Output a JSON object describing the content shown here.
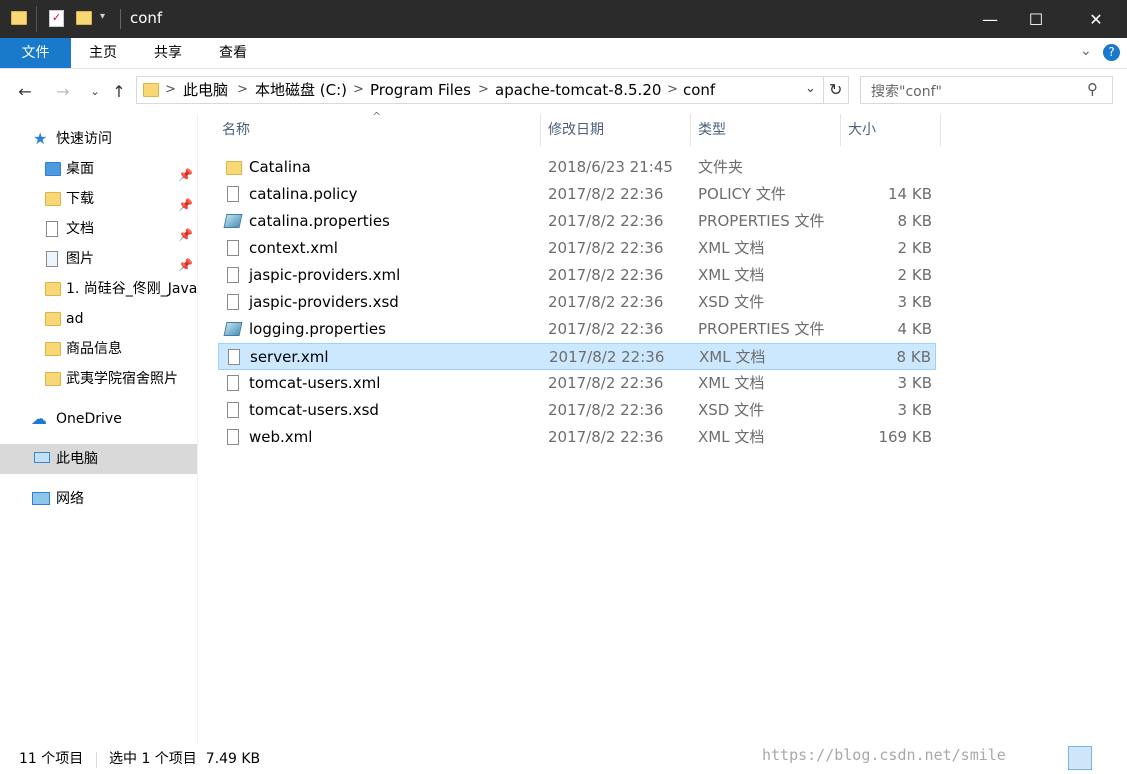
{
  "window": {
    "title": "conf",
    "minimize": "—",
    "maximize": "☐",
    "close": "✕"
  },
  "ribbon": {
    "tabs": [
      "文件",
      "主页",
      "共享",
      "查看"
    ],
    "expand_icon": "chevron-down-icon",
    "help": "?"
  },
  "address": {
    "crumbs": [
      "此电脑",
      "本地磁盘 (C:)",
      "Program Files",
      "apache-tomcat-8.5.20",
      "conf"
    ],
    "separator": ">",
    "search_placeholder": "搜索\"conf\""
  },
  "sidebar": {
    "quick_access": "快速访问",
    "items": [
      {
        "label": "桌面",
        "pinned": true
      },
      {
        "label": "下载",
        "pinned": true
      },
      {
        "label": "文档",
        "pinned": true
      },
      {
        "label": "图片",
        "pinned": true
      },
      {
        "label": "1. 尚硅谷_佟刚_Java",
        "pinned": false
      },
      {
        "label": "ad",
        "pinned": false
      },
      {
        "label": "商品信息",
        "pinned": false
      },
      {
        "label": "武夷学院宿舍照片",
        "pinned": false
      }
    ],
    "onedrive": "OneDrive",
    "this_pc": "此电脑",
    "network": "网络"
  },
  "columns": {
    "name": "名称",
    "date": "修改日期",
    "type": "类型",
    "size": "大小"
  },
  "files": [
    {
      "name": "Catalina",
      "date": "2018/6/23 21:45",
      "type": "文件夹",
      "size": "",
      "icon": "folder-icon"
    },
    {
      "name": "catalina.policy",
      "date": "2017/8/2 22:36",
      "type": "POLICY 文件",
      "size": "14 KB",
      "icon": "document-icon"
    },
    {
      "name": "catalina.properties",
      "date": "2017/8/2 22:36",
      "type": "PROPERTIES 文件",
      "size": "8 KB",
      "icon": "properties-icon"
    },
    {
      "name": "context.xml",
      "date": "2017/8/2 22:36",
      "type": "XML 文档",
      "size": "2 KB",
      "icon": "document-icon"
    },
    {
      "name": "jaspic-providers.xml",
      "date": "2017/8/2 22:36",
      "type": "XML 文档",
      "size": "2 KB",
      "icon": "document-icon"
    },
    {
      "name": "jaspic-providers.xsd",
      "date": "2017/8/2 22:36",
      "type": "XSD 文件",
      "size": "3 KB",
      "icon": "document-icon"
    },
    {
      "name": "logging.properties",
      "date": "2017/8/2 22:36",
      "type": "PROPERTIES 文件",
      "size": "4 KB",
      "icon": "properties-icon"
    },
    {
      "name": "server.xml",
      "date": "2017/8/2 22:36",
      "type": "XML 文档",
      "size": "8 KB",
      "icon": "document-icon",
      "selected": true
    },
    {
      "name": "tomcat-users.xml",
      "date": "2017/8/2 22:36",
      "type": "XML 文档",
      "size": "3 KB",
      "icon": "document-icon"
    },
    {
      "name": "tomcat-users.xsd",
      "date": "2017/8/2 22:36",
      "type": "XSD 文件",
      "size": "3 KB",
      "icon": "document-icon"
    },
    {
      "name": "web.xml",
      "date": "2017/8/2 22:36",
      "type": "XML 文档",
      "size": "169 KB",
      "icon": "document-icon"
    }
  ],
  "status": {
    "count": "11 个项目",
    "selection": "选中 1 个项目  7.49 KB"
  },
  "watermark": "https://blog.csdn.net/smile",
  "colors": {
    "accent": "#1979ca",
    "selection": "#cce8ff",
    "titlebar": "#2b2b2b"
  }
}
